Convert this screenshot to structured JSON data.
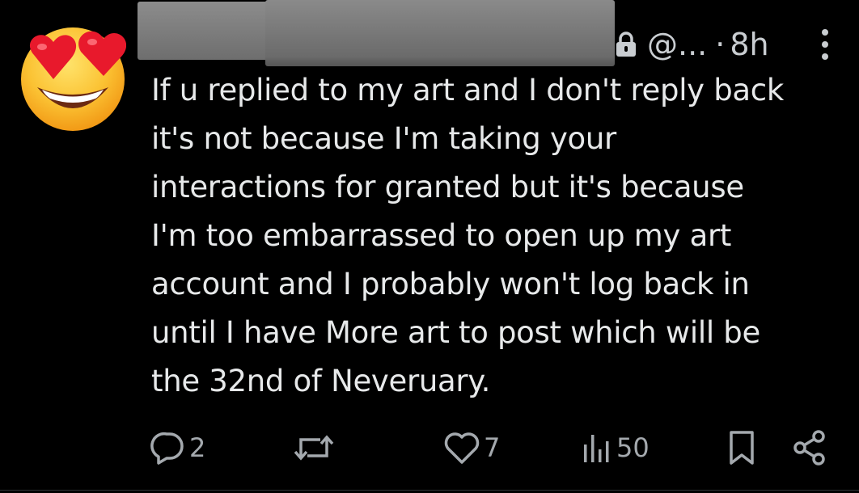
{
  "post": {
    "handle": "@...",
    "separator": "·",
    "time": "8h",
    "body": "If u replied to my art and I don't reply back\nit's not because I'm taking your\ninteractions for granted but it's because\nI'm too embarrassed to open up my art\naccount and I probably won't log back in\nuntil I have More art to post which will be\nthe 32nd of Neveruary."
  },
  "actions": {
    "replies": "2",
    "reposts": "",
    "likes": "7",
    "views": "50"
  },
  "icons": {
    "avatar": "heart-eyes-emoji",
    "lock": "lock-icon",
    "more": "vertical-dots-icon",
    "reply": "speech-bubble-icon",
    "repost": "repost-arrows-icon",
    "like": "heart-outline-icon",
    "views": "bar-chart-icon",
    "bookmark": "bookmark-icon",
    "share": "share-nodes-icon"
  },
  "colors": {
    "background": "#000000",
    "text": "#e7e9ea",
    "secondary": "#a4a9ae"
  }
}
